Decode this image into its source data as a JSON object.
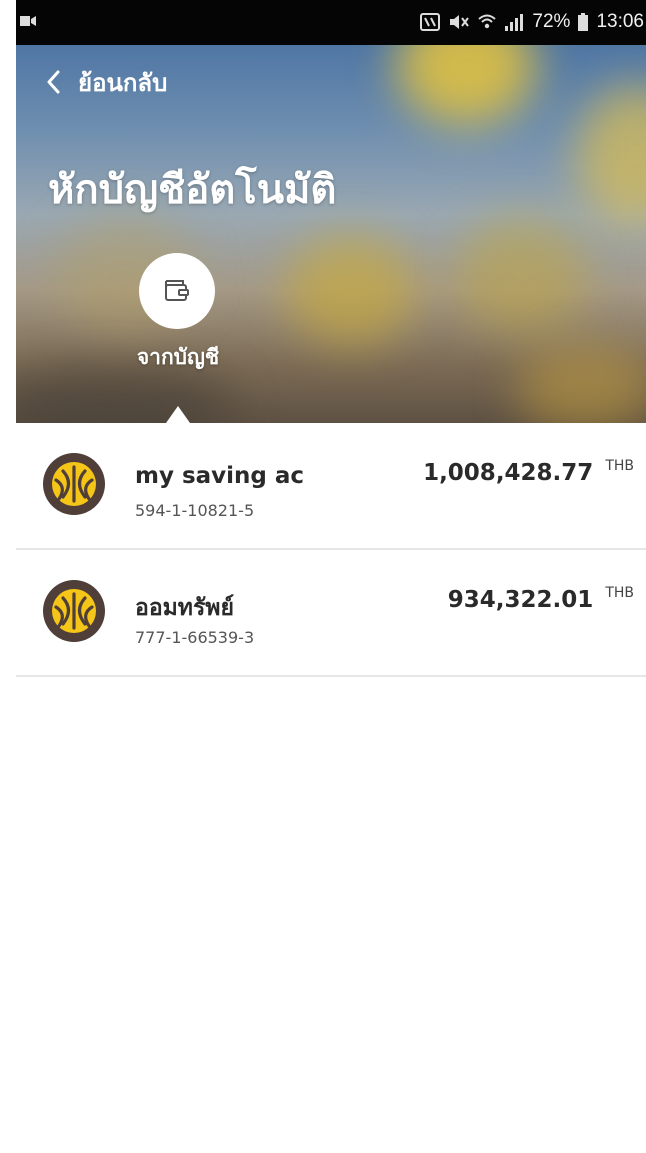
{
  "status_bar": {
    "battery_percent": "72%",
    "time": "13:06"
  },
  "header": {
    "back_label": "ย้อนกลับ",
    "title": "หักบัญชีอัตโนมัติ",
    "from_label": "จากบัญชี"
  },
  "accounts": [
    {
      "name": "my saving ac",
      "number": "594-1-10821-5",
      "balance": "1,008,428.77",
      "currency": "THB"
    },
    {
      "name": "ออมทรัพย์",
      "number": "777-1-66539-3",
      "balance": "934,322.01",
      "currency": "THB"
    }
  ],
  "colors": {
    "logo_bg": "#4f3f38",
    "logo_fg": "#f5c518",
    "header_sky": "#4f76a4"
  },
  "icons": {
    "back": "chevron-left-icon",
    "from_account": "wallet-icon",
    "bank_logo": "bank-logo-icon"
  }
}
